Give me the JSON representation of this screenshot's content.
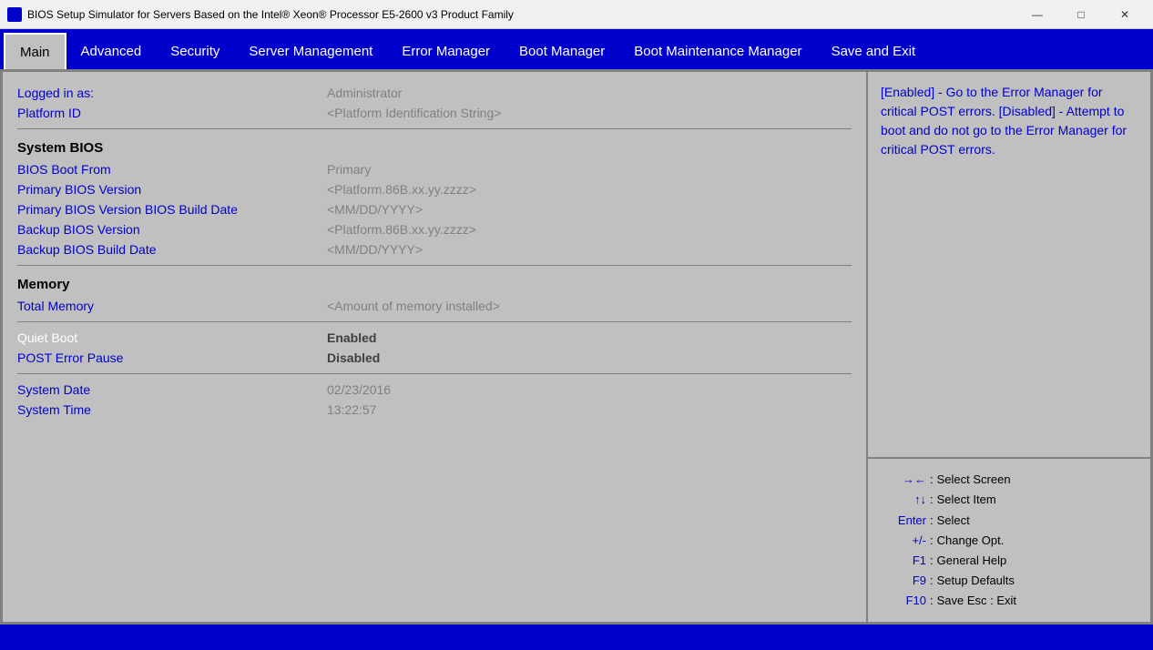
{
  "titlebar": {
    "text": "BIOS Setup Simulator for Servers Based on the Intel® Xeon® Processor E5-2600 v3 Product Family",
    "minimize": "—",
    "maximize": "□",
    "close": "✕"
  },
  "nav": {
    "items": [
      {
        "id": "main",
        "label": "Main",
        "active": true
      },
      {
        "id": "advanced",
        "label": "Advanced",
        "active": false
      },
      {
        "id": "security",
        "label": "Security",
        "active": false
      },
      {
        "id": "server-management",
        "label": "Server Management",
        "active": false
      },
      {
        "id": "error-manager",
        "label": "Error Manager",
        "active": false
      },
      {
        "id": "boot-manager",
        "label": "Boot Manager",
        "active": false
      },
      {
        "id": "boot-maintenance-manager",
        "label": "Boot Maintenance Manager",
        "active": false
      },
      {
        "id": "save-and-exit",
        "label": "Save and Exit",
        "active": false
      }
    ]
  },
  "main": {
    "fields": [
      {
        "label": "Logged in as:",
        "value": "Administrator",
        "label_style": "blue",
        "value_style": "gray"
      },
      {
        "label": "Platform ID",
        "value": "<Platform Identification String>",
        "label_style": "blue",
        "value_style": "gray"
      }
    ],
    "system_bios_header": "System BIOS",
    "bios_fields": [
      {
        "label": "BIOS Boot From",
        "value": "Primary",
        "label_style": "blue",
        "value_style": "gray"
      },
      {
        "label": "Primary BIOS Version",
        "value": "<Platform.86B.xx.yy.zzzz>",
        "label_style": "blue",
        "value_style": "gray"
      },
      {
        "label": "Primary BIOS Version BIOS Build Date",
        "value": "<MM/DD/YYYY>",
        "label_style": "blue",
        "value_style": "gray"
      },
      {
        "label": "Backup BIOS Version",
        "value": "<Platform.86B.xx.yy.zzzz>",
        "label_style": "blue",
        "value_style": "gray"
      },
      {
        "label": "Backup BIOS Build Date",
        "value": "<MM/DD/YYYY>",
        "label_style": "blue",
        "value_style": "gray"
      }
    ],
    "memory_header": "Memory",
    "memory_fields": [
      {
        "label": "Total Memory",
        "value": "<Amount of memory installed>",
        "label_style": "blue",
        "value_style": "gray"
      }
    ],
    "other_fields": [
      {
        "label": "Quiet Boot",
        "value": "Enabled",
        "label_style": "white",
        "value_style": "bold"
      },
      {
        "label": "POST Error Pause",
        "value": "Disabled",
        "label_style": "blue",
        "value_style": "bold"
      }
    ],
    "date_fields": [
      {
        "label": "System Date",
        "value": "02/23/2016",
        "label_style": "blue",
        "value_style": "gray"
      },
      {
        "label": "System Time",
        "value": "13:22:57",
        "label_style": "blue",
        "value_style": "gray"
      }
    ]
  },
  "help": {
    "text": "[Enabled] - Go to the Error Manager for critical POST errors. [Disabled] - Attempt to boot and do not go to the Error Manager for critical POST errors."
  },
  "keys": [
    {
      "key": "→←",
      "separator": ":",
      "desc": "Select Screen"
    },
    {
      "key": "↑↓",
      "separator": ":",
      "desc": "Select Item"
    },
    {
      "key": "Enter",
      "separator": ":",
      "desc": "Select"
    },
    {
      "key": "+/-",
      "separator": ":",
      "desc": "Change Opt."
    },
    {
      "key": "F1",
      "separator": ":",
      "desc": "General Help"
    },
    {
      "key": "F9",
      "separator": ":",
      "desc": "Setup Defaults"
    },
    {
      "key": "F10",
      "separator": ":",
      "desc": "Save     Esc :  Exit"
    }
  ]
}
